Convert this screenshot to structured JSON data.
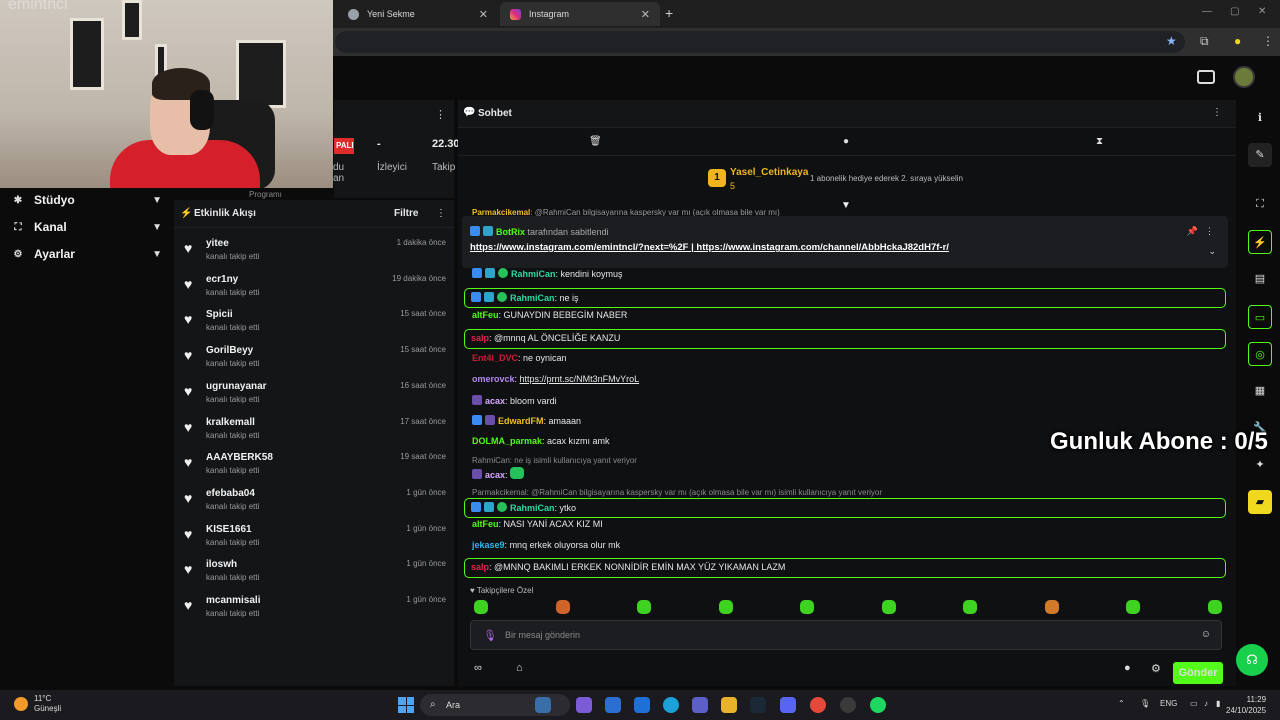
{
  "browser": {
    "tabs": [
      {
        "label": "Yeni Sekme"
      },
      {
        "label": "Instagram"
      }
    ]
  },
  "webcam": {
    "watermark": "emintncl"
  },
  "sidebar": {
    "items": [
      {
        "label": "Stüdyo",
        "icon": "studio-icon"
      },
      {
        "label": "Kanal",
        "icon": "channel-icon"
      },
      {
        "label": "Ayarlar",
        "icon": "gear-icon"
      }
    ]
  },
  "stats": {
    "live_badge": "PALI",
    "viewers_value": "-",
    "viewers_label": "İzleyici",
    "followers_value": "22.30",
    "followers_label": "Takip",
    "col1_partial_a": "du",
    "col1_partial_b": "an",
    "program": "Programı"
  },
  "activity": {
    "title": "Etkinlik Akışı",
    "filter": "Filtre",
    "items": [
      {
        "name": "yitee",
        "sub": "kanalı takip etti",
        "time": "1 dakika önce"
      },
      {
        "name": "ecr1ny",
        "sub": "kanalı takip etti",
        "time": "19 dakika önce"
      },
      {
        "name": "Spicii",
        "sub": "kanalı takip etti",
        "time": "15 saat önce"
      },
      {
        "name": "GorilBeyy",
        "sub": "kanalı takip etti",
        "time": "15 saat önce"
      },
      {
        "name": "ugrunayanar",
        "sub": "kanalı takip etti",
        "time": "16 saat önce"
      },
      {
        "name": "kralkemall",
        "sub": "kanalı takip etti",
        "time": "17 saat önce"
      },
      {
        "name": "AAAYBERK58",
        "sub": "kanalı takip etti",
        "time": "19 saat önce"
      },
      {
        "name": "efebaba04",
        "sub": "kanalı takip etti",
        "time": "1 gün önce"
      },
      {
        "name": "KISE1661",
        "sub": "kanalı takip etti",
        "time": "1 gün önce"
      },
      {
        "name": "iloswh",
        "sub": "kanalı takip etti",
        "time": "1 gün önce"
      },
      {
        "name": "mcanmisali",
        "sub": "kanalı takip etti",
        "time": "1 gün önce"
      }
    ]
  },
  "chat": {
    "title": "Sohbet",
    "gift": {
      "rank": "1",
      "user": "Yasel_Cetinkaya",
      "count": "5",
      "message": "1 abonelik hediye ederek 2. sıraya yükselin"
    },
    "pinned": {
      "user": "BotRix",
      "note": "tarafından sabitlendi",
      "link1": "https://www.instagram.com/emintncl/?next=%2F",
      "sep": "|",
      "link2": "https://www.instagram.com/channel/AbbHckaJ82dH7f-r/"
    },
    "cut_line": {
      "user": "Parmakcikemal",
      "text": "@RahmiCan bilgisayarına kaspersky var mı (açık olmasa bile var mı)"
    },
    "messages": [
      {
        "user": "RahmiCan",
        "text": "kendini koymuş",
        "color": "#2fd7a0"
      },
      {
        "user": "RahmiCan",
        "text": "ne iş",
        "color": "#2fd7a0"
      },
      {
        "user": "altFeu",
        "text": "GUNAYDIN BEBEGİM NABER",
        "color": "#53fc18"
      },
      {
        "user": "salp",
        "text": "@mnnq AL ÖNCELİĞE KANZU",
        "color": "#e0244a"
      },
      {
        "user": "Ent4l_DVC",
        "text": "ne oynican",
        "color": "#c81d3a"
      },
      {
        "user": "omerovck",
        "text": "https://prnt.sc/NMt3nFMvYroL",
        "color": "#b586f0"
      },
      {
        "user": "acax",
        "text": "bloom vardi",
        "color": "#d8a8ff"
      },
      {
        "user": "EdwardFM",
        "text": "amaaan",
        "color": "#f0c020"
      },
      {
        "user": "DOLMA_parmak",
        "text": "acax kızmı amk",
        "color": "#53fc18"
      },
      {
        "user": "acax",
        "text": "",
        "color": "#d8a8ff"
      },
      {
        "user": "RahmiCan",
        "text": "ytko",
        "color": "#2fd7a0"
      },
      {
        "user": "altFeu",
        "text": "NASI YANİ ACAX KIZ MI",
        "color": "#53fc18"
      },
      {
        "user": "jekase9",
        "text": "mnq erkek oluyorsa olur mk",
        "color": "#2fb8f0"
      },
      {
        "user": "salp",
        "text": "@MNNQ BAKIMLI ERKEK NONNİDİR EMİN MAX YÜZ YIKAMAN LAZM",
        "color": "#e0244a"
      }
    ],
    "replies": [
      {
        "text": "RahmiCan: ne iş isimli kullanıcıya yanıt veriyor"
      },
      {
        "text": "Parmakcikemal: @RahmiCan bilgisayarına kaspersky var mı (açık olmasa bile var mı) isimli kullanıcıya yanıt veriyor"
      }
    ],
    "emotes_label": "Takipçilere Özel",
    "input_placeholder": "Bir mesaj gönderin",
    "send": "Gönder"
  },
  "overlay": {
    "text": "Gunluk Abone : 0/5"
  },
  "taskbar": {
    "temp": "11°C",
    "weather": "Güneşli",
    "search": "Ara",
    "lang": "ENG",
    "time": "11:29",
    "date": "24/10/2025"
  },
  "colors": {
    "accent": "#53fc18",
    "bg": "#0b0b0c",
    "panel": "#141517"
  }
}
